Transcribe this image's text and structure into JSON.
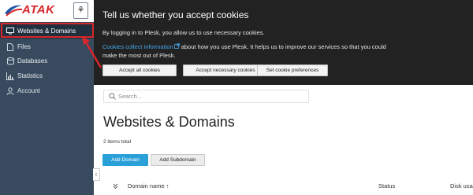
{
  "brand": {
    "name": "ATAK",
    "color": "#d8262a"
  },
  "sidebar": {
    "items": [
      {
        "label": "Websites & Domains",
        "icon": "monitor-icon",
        "active": true
      },
      {
        "label": "Files",
        "icon": "file-icon"
      },
      {
        "label": "Databases",
        "icon": "database-icon"
      },
      {
        "label": "Statistics",
        "icon": "statistics-icon"
      },
      {
        "label": "Account",
        "icon": "user-icon"
      }
    ],
    "collapse_glyph": "‹"
  },
  "cookie_banner": {
    "title": "Tell us whether you accept cookies",
    "line1": "By logging in to Plesk, you allow us to use necessary cookies.",
    "link_text": "Cookies collect information",
    "line2_rest": " about how you use Plesk. It helps us to improve our services so that you could make the most out of Plesk.",
    "buttons": {
      "accept_all": "Accept all cookies",
      "accept_necessary": "Accept necessary cookies",
      "preferences": "Set cookie preferences"
    }
  },
  "search": {
    "placeholder": "Search..."
  },
  "main": {
    "title": "Websites & Domains",
    "items_total": "2 items total",
    "add_domain": "Add Domain",
    "add_subdomain": "Add Subdomain"
  },
  "table": {
    "columns": {
      "domain_name": "Domain name ↑",
      "status": "Status",
      "disk_usage": "Disk usa"
    }
  },
  "colors": {
    "accent": "#2aa0d9",
    "sidebar_bg": "#374a5e",
    "banner_bg": "#222222",
    "link": "#44a6e6"
  }
}
